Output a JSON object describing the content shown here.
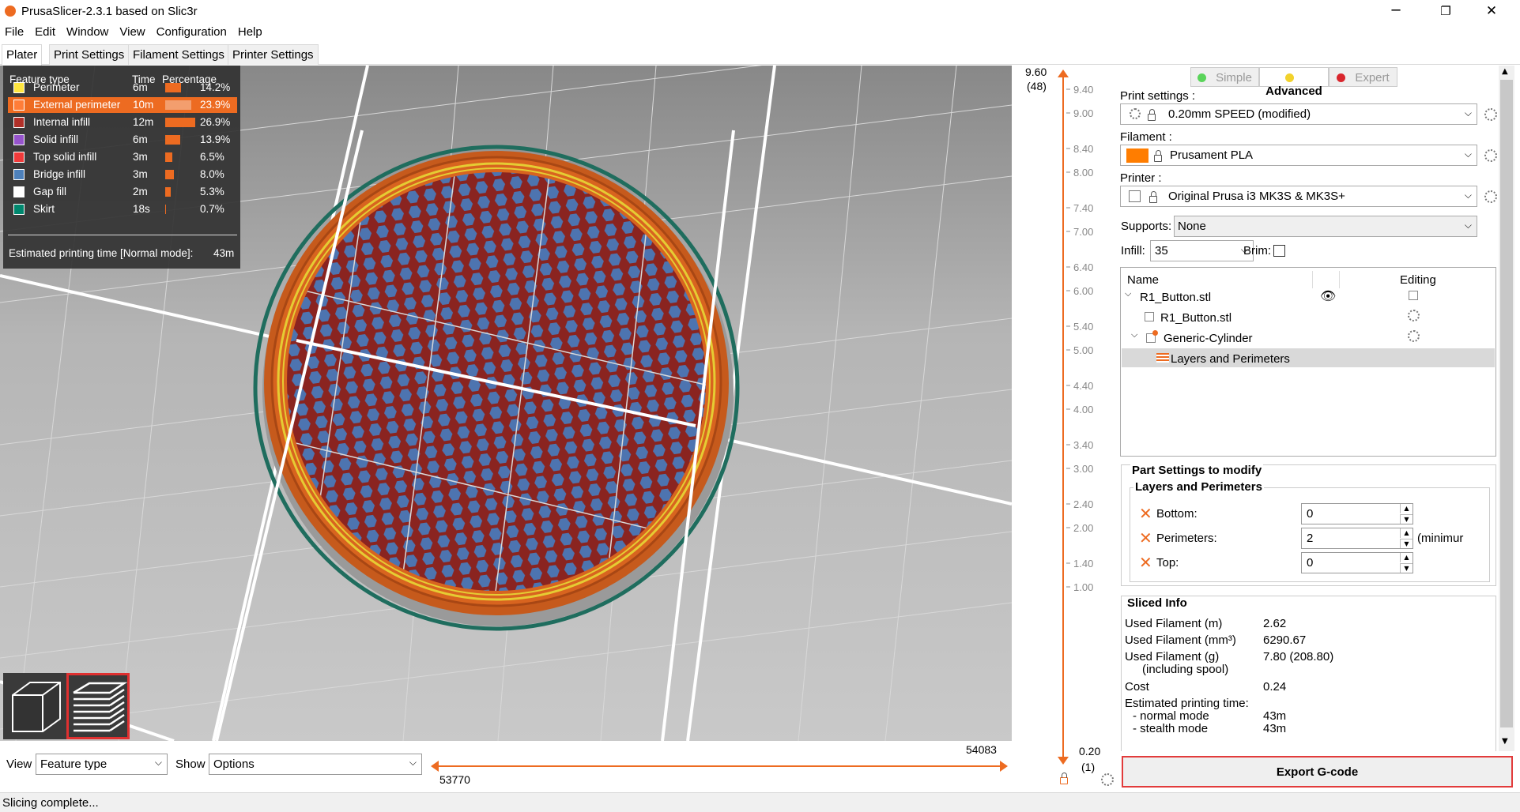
{
  "window": {
    "title": "PrusaSlicer-2.3.1 based on Slic3r",
    "minimize": "─",
    "restore": "❐",
    "close": "✕"
  },
  "menu": [
    "File",
    "Edit",
    "Window",
    "View",
    "Configuration",
    "Help"
  ],
  "tabs": [
    "Plater",
    "Print Settings",
    "Filament Settings",
    "Printer Settings"
  ],
  "legend": {
    "headers": {
      "feature": "Feature type",
      "time": "Time",
      "pct": "Percentage"
    },
    "rows": [
      {
        "label": "Perimeter",
        "time": "6m",
        "pct": "14.2%",
        "share": 14.2,
        "color": "#ffe640",
        "highlight": false
      },
      {
        "label": "External perimeter",
        "time": "10m",
        "pct": "23.9%",
        "share": 23.9,
        "color": "#ff7d38",
        "highlight": true
      },
      {
        "label": "Internal infill",
        "time": "12m",
        "pct": "26.9%",
        "share": 26.9,
        "color": "#b03029",
        "highlight": false
      },
      {
        "label": "Solid infill",
        "time": "6m",
        "pct": "13.9%",
        "share": 13.9,
        "color": "#9654cc",
        "highlight": false
      },
      {
        "label": "Top solid infill",
        "time": "3m",
        "pct": "6.5%",
        "share": 6.5,
        "color": "#f03a3a",
        "highlight": false
      },
      {
        "label": "Bridge infill",
        "time": "3m",
        "pct": "8.0%",
        "share": 8.0,
        "color": "#4d80ba",
        "highlight": false
      },
      {
        "label": "Gap fill",
        "time": "2m",
        "pct": "5.3%",
        "share": 5.3,
        "color": "#ffffff",
        "highlight": false
      },
      {
        "label": "Skirt",
        "time": "18s",
        "pct": "0.7%",
        "share": 0.7,
        "color": "#00876e",
        "highlight": false
      }
    ],
    "estimate_label": "Estimated printing time [Normal mode]:",
    "estimate_value": "43m"
  },
  "bottom": {
    "view_label": "View",
    "view_value": "Feature type",
    "show_label": "Show",
    "show_value": "Options",
    "h_right": "54083",
    "h_left": "53770"
  },
  "vslider": {
    "top_value": "9.60",
    "top_layer": "(48)",
    "bottom_value": "0.20",
    "bottom_layer": "(1)",
    "ticks": [
      "9.40",
      "9.00",
      "8.40",
      "8.00",
      "7.40",
      "7.00",
      "6.40",
      "6.00",
      "5.40",
      "5.00",
      "4.40",
      "4.00",
      "3.40",
      "3.00",
      "2.40",
      "2.00",
      "1.40",
      "1.00"
    ]
  },
  "modes": {
    "simple": "Simple",
    "advanced": "Advanced",
    "expert": "Expert"
  },
  "print": {
    "label": "Print settings :",
    "value": "0.20mm SPEED (modified)"
  },
  "filament": {
    "label": "Filament :",
    "value": "Prusament PLA",
    "color": "#ff7d00"
  },
  "printer": {
    "label": "Printer :",
    "value": "Original Prusa i3 MK3S & MK3S+"
  },
  "supports": {
    "label": "Supports:",
    "value": "None"
  },
  "infill": {
    "label": "Infill:",
    "value": "35"
  },
  "brim": {
    "label": "Brim:"
  },
  "objects": {
    "col_name": "Name",
    "col_editing": "Editing",
    "items": [
      "R1_Button.stl",
      "R1_Button.stl",
      "Generic-Cylinder",
      "Layers and Perimeters"
    ]
  },
  "part": {
    "title": "Part Settings to modify",
    "subtitle": "Layers and Perimeters",
    "bottom_label": "Bottom:",
    "bottom_value": "0",
    "perimeters_label": "Perimeters:",
    "perimeters_value": "2",
    "perimeters_note": "(minimur",
    "top_label": "Top:",
    "top_value": "0"
  },
  "sliced": {
    "title": "Sliced Info",
    "rows": [
      {
        "label": "Used Filament (m)",
        "value": "2.62"
      },
      {
        "label": "Used Filament (mm³)",
        "value": "6290.67"
      },
      {
        "label": "Used Filament (g)",
        "value": "7.80 (208.80)"
      },
      {
        "label": "(including spool)",
        "value": ""
      },
      {
        "label": "Cost",
        "value": "0.24"
      },
      {
        "label": "Estimated printing time:",
        "value": ""
      },
      {
        "label": "- normal mode",
        "value": "43m"
      },
      {
        "label": "- stealth mode",
        "value": "43m"
      }
    ]
  },
  "export": "Export G-code",
  "status": "Slicing complete..."
}
